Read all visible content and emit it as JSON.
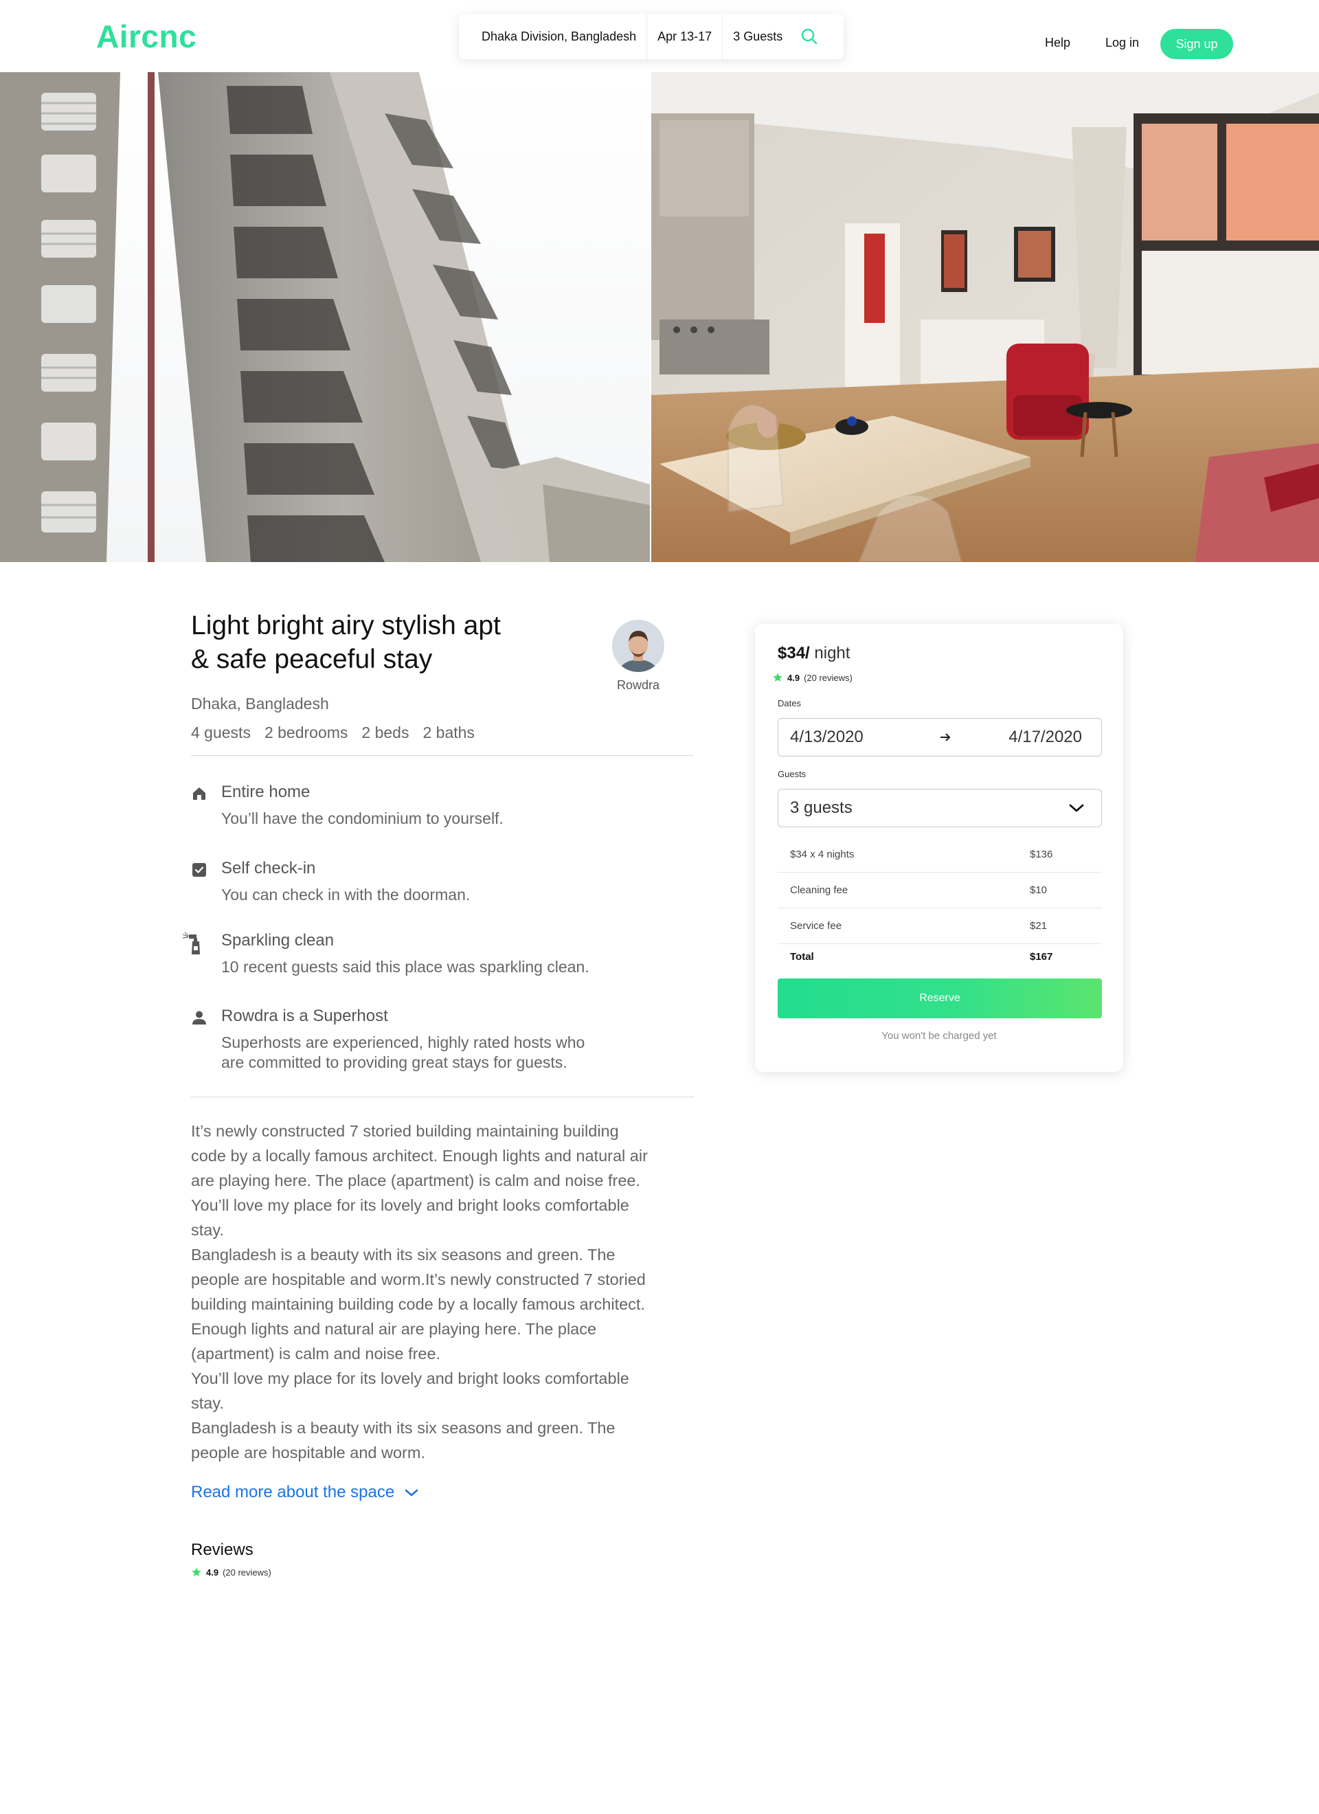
{
  "header": {
    "logo": "Aircnc",
    "search": {
      "location": "Dhaka Division, Bangladesh",
      "dates": "Apr 13-17",
      "guests": "3 Guests",
      "search_icon": "search-icon"
    },
    "nav": {
      "help": "Help",
      "login": "Log in",
      "signup": "Sign up"
    }
  },
  "listing": {
    "title_line1": "Light bright airy stylish apt",
    "title_line2": "& safe peaceful stay",
    "host_name": "Rowdra",
    "location": "Dhaka, Bangladesh",
    "specs": [
      "4 guests",
      "2 bedrooms",
      "2 beds",
      "2 baths"
    ],
    "features": [
      {
        "icon": "home-icon",
        "title": "Entire home",
        "desc": "You’ll have the condominium to yourself."
      },
      {
        "icon": "checkbox-icon",
        "title": "Self check-in",
        "desc": "You can check in with the doorman."
      },
      {
        "icon": "spray-bottle-icon",
        "title": "Sparkling clean",
        "desc": "10 recent guests said this place was sparkling clean."
      },
      {
        "icon": "person-icon",
        "title": "Rowdra is a Superhost",
        "desc_line1": "Superhosts are experienced, highly rated hosts who",
        "desc_line2": "are committed to providing great stays for guests."
      }
    ],
    "description": [
      "It’s newly constructed 7 storied building maintaining building",
      "code by a locally famous architect. Enough lights and natural air",
      "are playing here. The place (apartment) is calm and noise free.",
      "You’ll love my place for its lovely and bright looks comfortable",
      "stay.",
      "Bangladesh is a beauty with its six seasons and green. The",
      "people are hospitable and worm.It’s newly constructed 7 storied",
      "building maintaining building code by a locally famous architect.",
      "Enough lights and natural air are playing here. The place",
      "(apartment) is calm and noise free.",
      "You’ll love my place for its lovely and bright looks comfortable",
      "stay.",
      "Bangladesh is a beauty with its six seasons and green. The",
      "people are hospitable and worm."
    ],
    "read_more": "Read more about the space",
    "reviews_title": "Reviews",
    "rating": "4.9",
    "reviews_count": "(20 reviews)"
  },
  "booking": {
    "price": "$34/",
    "per_night": " night",
    "rating": "4.9",
    "reviews_count": "(20 reviews)",
    "dates_label": "Dates",
    "check_in": "4/13/2020",
    "check_out": "4/17/2020",
    "guests_label": "Guests",
    "guests_value": "3 guests",
    "lines": [
      {
        "label": "$34 x 4 nights",
        "amount": "$136"
      },
      {
        "label": "Cleaning fee",
        "amount": "$10"
      },
      {
        "label": "Service fee",
        "amount": "$21"
      }
    ],
    "total_label": "Total",
    "total_amount": "$167",
    "reserve": "Reserve",
    "no_charge": "You won't be charged yet"
  },
  "colors": {
    "brand": "#2ee09a",
    "link": "#1a73e8",
    "star": "#3ddc6a"
  }
}
